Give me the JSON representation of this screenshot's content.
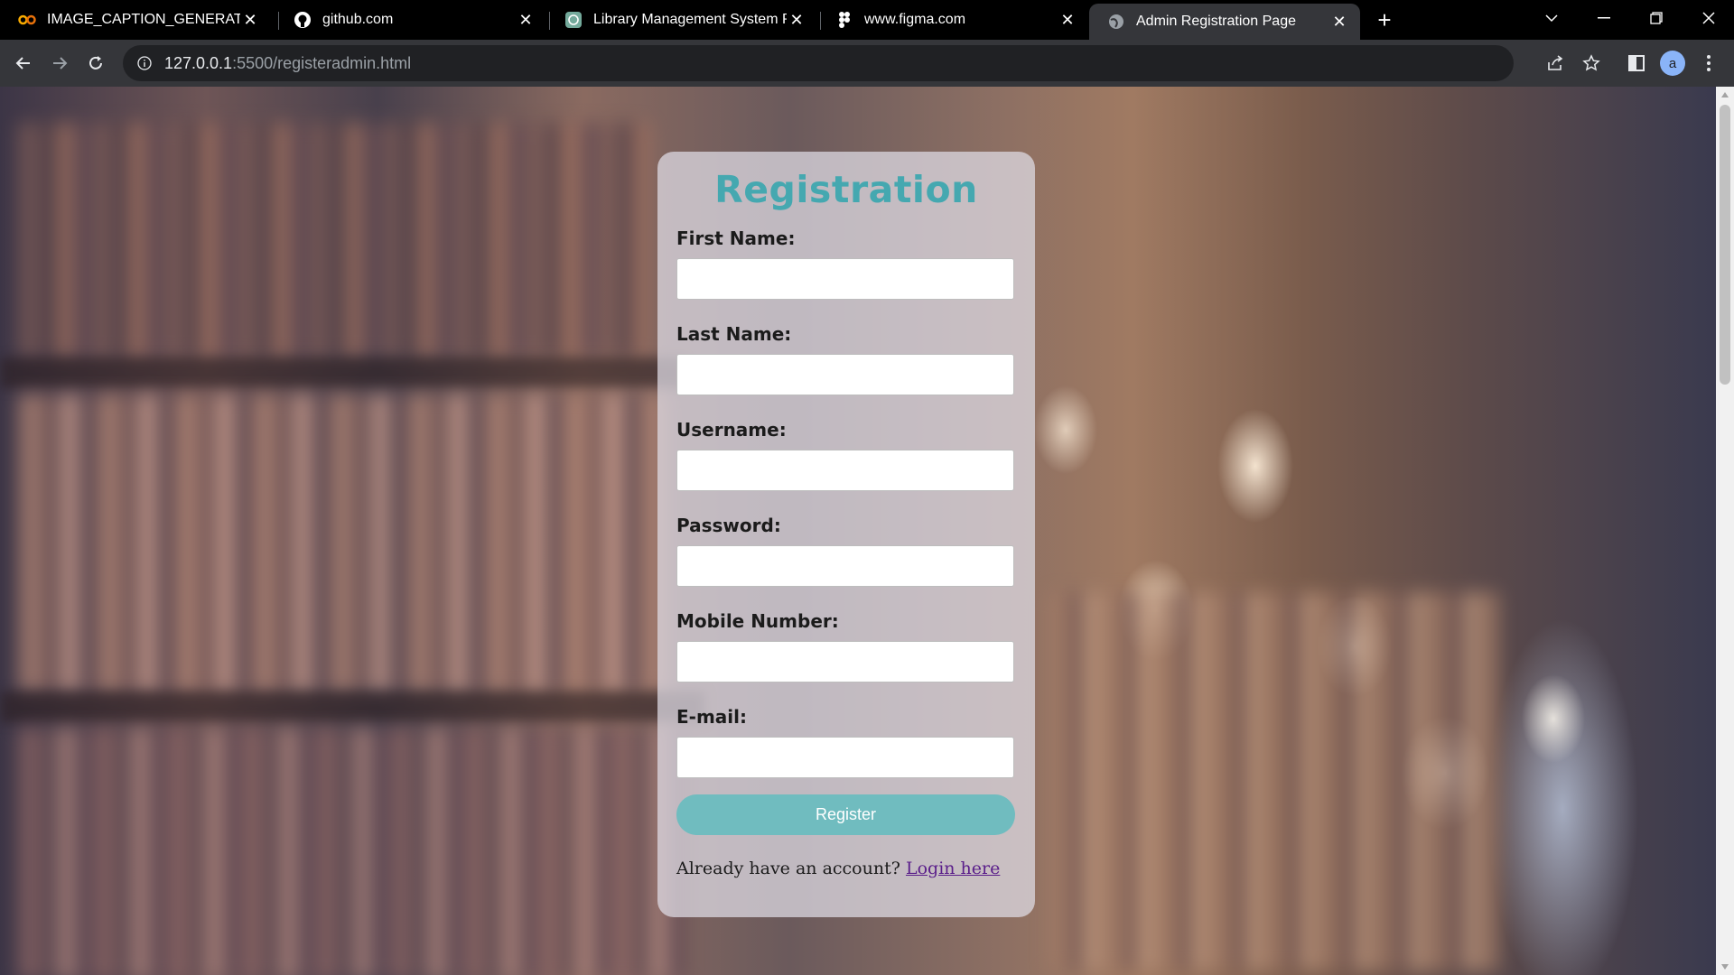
{
  "browser": {
    "tabs": [
      {
        "title": "IMAGE_CAPTION_GENERATOR.ip",
        "icon": "colab-icon",
        "active": false
      },
      {
        "title": "github.com",
        "icon": "github-icon",
        "active": false
      },
      {
        "title": "Library Management System Pur",
        "icon": "chatgpt-icon",
        "active": false
      },
      {
        "title": "www.figma.com",
        "icon": "figma-icon",
        "active": false
      },
      {
        "title": "Admin Registration Page",
        "icon": "globe-icon",
        "active": true
      }
    ],
    "address": {
      "host": "127.0.0.1",
      "path": ":5500/registeradmin.html"
    },
    "profile_initial": "a"
  },
  "form": {
    "title": "Registration",
    "fields": [
      {
        "label": "First Name:",
        "value": ""
      },
      {
        "label": "Last Name:",
        "value": ""
      },
      {
        "label": "Username:",
        "value": ""
      },
      {
        "label": "Password:",
        "value": ""
      },
      {
        "label": "Mobile Number:",
        "value": ""
      },
      {
        "label": "E-mail:",
        "value": ""
      }
    ],
    "submit_label": "Register",
    "login_prompt": "Already have an account?",
    "login_link": "Login here"
  },
  "colors": {
    "title": "#45a8b0",
    "button": "#70bcbf",
    "link": "#5a1e8a"
  }
}
